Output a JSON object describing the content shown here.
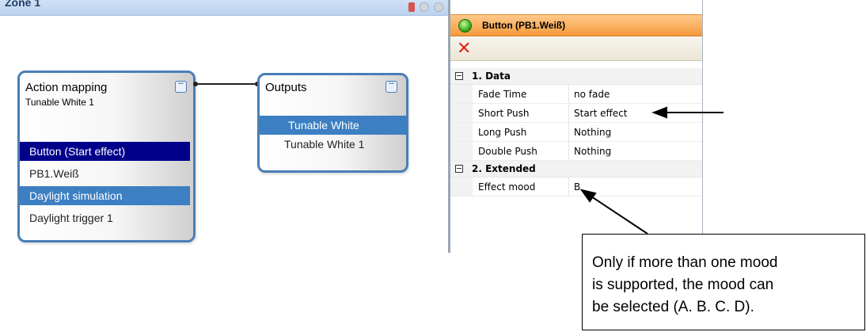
{
  "canvas": {
    "title": "Zone 1"
  },
  "action_node": {
    "title": "Action mapping",
    "subtitle": "Tunable White 1",
    "collapse_glyph": "double-chevron-up-icon",
    "rows": [
      "Button (Start effect)",
      "PB1.Weiß",
      "Daylight simulation",
      "Daylight trigger 1"
    ]
  },
  "outputs_node": {
    "title": "Outputs",
    "collapse_glyph": "double-chevron-up-icon",
    "rows": [
      "Tunable White",
      "Tunable White 1"
    ]
  },
  "panel": {
    "title": "Button (PB1.Weiß)",
    "status_color": "#3fae1b",
    "categories": [
      {
        "label": "1. Data",
        "properties": [
          {
            "name": "Fade Time",
            "value": "no fade"
          },
          {
            "name": "Short Push",
            "value": "Start effect"
          },
          {
            "name": "Long Push",
            "value": "Nothing"
          },
          {
            "name": "Double Push",
            "value": "Nothing"
          }
        ]
      },
      {
        "label": "2. Extended",
        "properties": [
          {
            "name": "Effect mood",
            "value": "B"
          }
        ]
      }
    ]
  },
  "callout": {
    "lines": [
      "Only if more than one mood",
      "is supported, the mood can",
      "be selected (A. B. C. D)."
    ]
  },
  "colors": {
    "node_border": "#4a7eb8",
    "selected_dark": "#00008b",
    "selected_mid": "#3c7fc2",
    "panel_header": "#f59a3c"
  }
}
